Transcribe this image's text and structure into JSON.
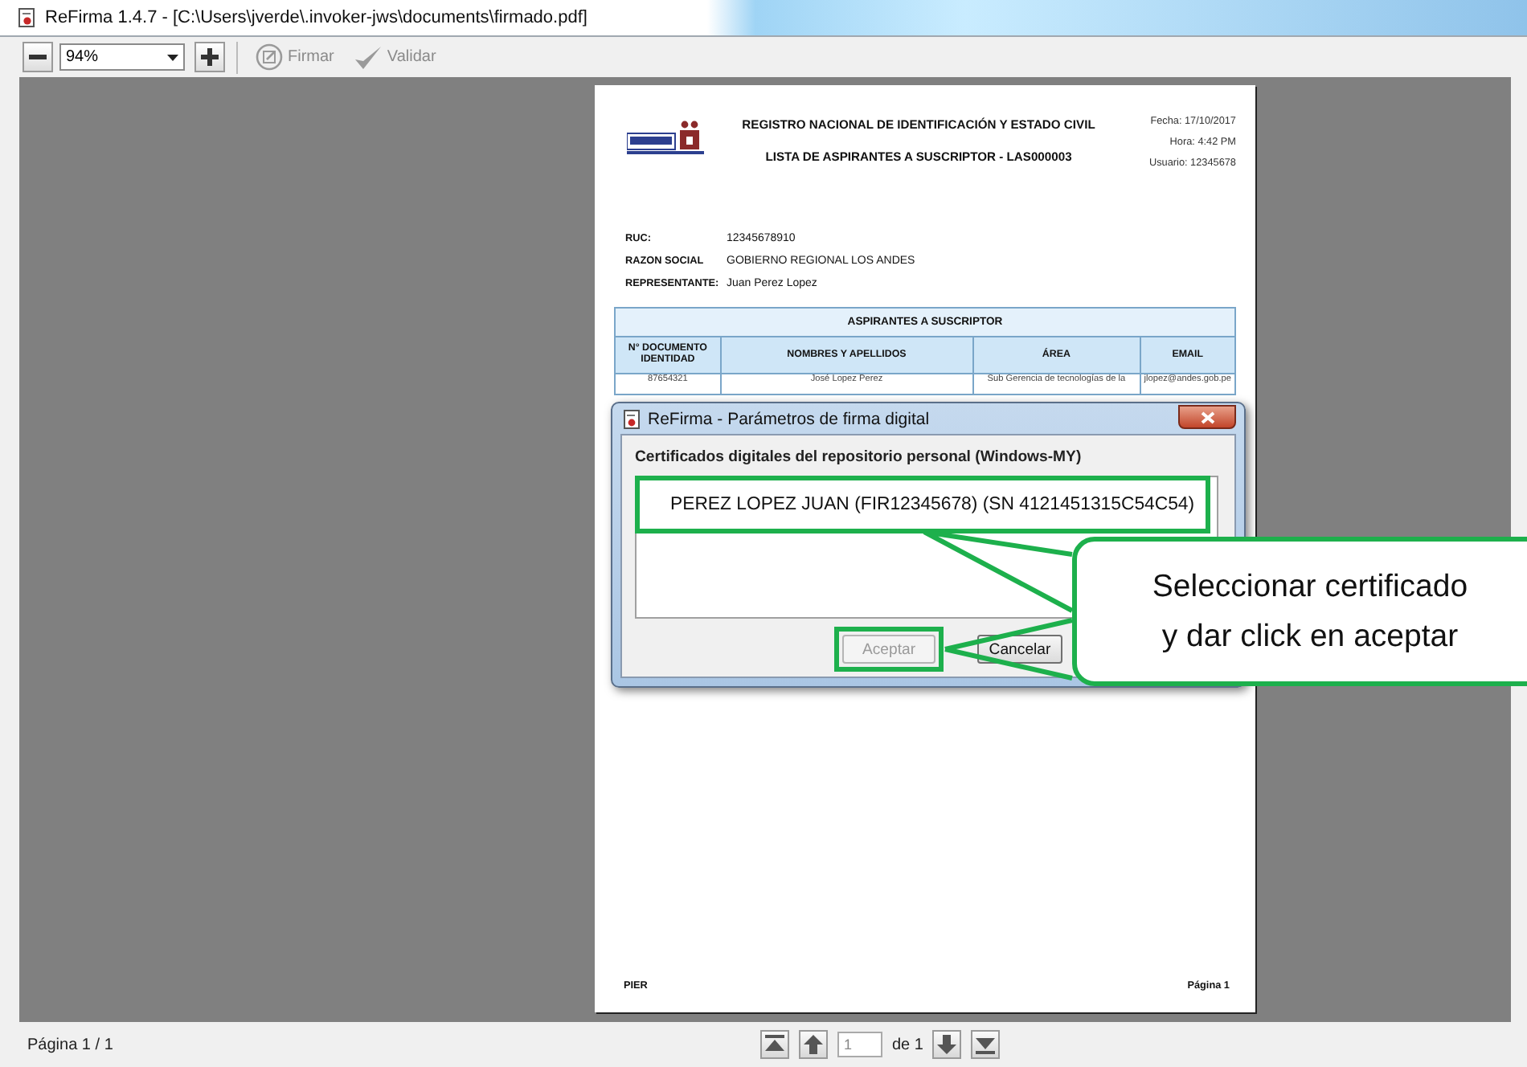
{
  "window": {
    "title": "ReFirma 1.4.7 - [C:\\Users\\jverde\\.invoker-jws\\documents\\firmado.pdf]"
  },
  "toolbar": {
    "zoom": "94%",
    "buttons": [
      {
        "kind": "sign",
        "label": "Firmar",
        "disabled": true
      },
      {
        "kind": "validate",
        "label": "Validar",
        "disabled": true
      }
    ]
  },
  "document": {
    "title": "REGISTRO NACIONAL DE IDENTIFICACIÓN Y ESTADO CIVIL",
    "subtitle": "LISTA DE ASPIRANTES A SUSCRIPTOR - LAS000003",
    "meta": [
      "Fecha: 17/10/2017",
      "Hora: 4:42 PM",
      "Usuario: 12345678"
    ],
    "fields": [
      {
        "label": "RUC:",
        "value": "12345678910"
      },
      {
        "label": "RAZON SOCIAL",
        "value": "GOBIERNO REGIONAL LOS ANDES"
      },
      {
        "label": "REPRESENTANTE:",
        "value": "Juan Perez Lopez"
      }
    ],
    "table": {
      "title": "ASPIRANTES A SUSCRIPTOR",
      "columns": [
        "N° DOCUMENTO IDENTIDAD",
        "NOMBRES Y APELLIDOS",
        "ÁREA",
        "EMAIL"
      ],
      "rows": [
        [
          "87654321",
          "José Lopez Perez",
          "Sub Gerencia de tecnologías de la",
          "jlopez@andes.gob.pe"
        ]
      ]
    },
    "footer_left": "PIER",
    "footer_right": "Página 1"
  },
  "dialog": {
    "title": "ReFirma - Parámetros de firma digital",
    "group_label": "Certificados digitales del repositorio personal (Windows-MY)",
    "certificates": [
      {
        "label": "PEREZ LOPEZ JUAN (FIR12345678) (SN 4121451315C54C54)",
        "selected": true
      }
    ],
    "buttons": [
      {
        "label": "Aceptar",
        "disabled": true
      },
      {
        "label": "Cancelar",
        "disabled": false
      }
    ]
  },
  "callout": {
    "lines": [
      "Seleccionar certificado",
      "y dar click en aceptar"
    ]
  },
  "navigation": {
    "page": "1",
    "total": "de 1"
  },
  "status_bar": "Página 1 / 1"
}
